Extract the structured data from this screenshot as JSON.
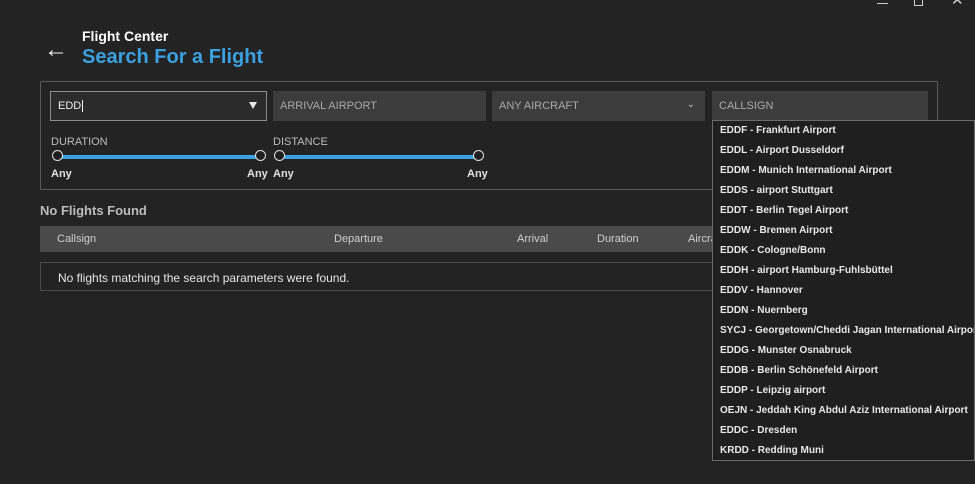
{
  "window_controls": {
    "minimize": "—",
    "maximize": "",
    "close": "✕"
  },
  "header": {
    "back_icon": "left-arrow-icon",
    "app_title": "Flight Center",
    "page_title": "Search For a Flight"
  },
  "search": {
    "departure_value": "EDD",
    "arrival_placeholder": "ARRIVAL AIRPORT",
    "aircraft_selected": "ANY AIRCRAFT",
    "callsign_placeholder": "CALLSIGN",
    "duration": {
      "label": "DURATION",
      "min_label": "Any",
      "max_label": "Any",
      "range": [
        0,
        1
      ]
    },
    "distance": {
      "label": "DISTANCE",
      "min_label": "Any",
      "max_label": "Any",
      "range": [
        0,
        1
      ]
    }
  },
  "results": {
    "heading": "No Flights Found",
    "columns": [
      "Callsign",
      "Departure",
      "Arrival",
      "Duration",
      "Aircra"
    ],
    "empty_message": "No flights matching the search parameters were found."
  },
  "dropdown": {
    "items": [
      "EDDF - Frankfurt Airport",
      "EDDL - Airport Dusseldorf",
      "EDDM - Munich International Airport",
      "EDDS - airport Stuttgart",
      "EDDT - Berlin Tegel Airport",
      "EDDW - Bremen Airport",
      "EDDK - Cologne/Bonn",
      "EDDH - airport Hamburg-Fuhlsbüttel",
      "EDDV - Hannover",
      "EDDN - Nuernberg",
      "SYCJ - Georgetown/Cheddi Jagan International Airport",
      "EDDG - Munster Osnabruck",
      "EDDB - Berlin Schönefeld Airport",
      "EDDP - Leipzig airport",
      "OEJN - Jeddah King Abdul Aziz International Airport",
      "EDDC - Dresden",
      "KRDD - Redding Muni"
    ]
  },
  "colors": {
    "accent": "#3aa0e0",
    "background": "#232323",
    "field": "#3c3c3c"
  }
}
